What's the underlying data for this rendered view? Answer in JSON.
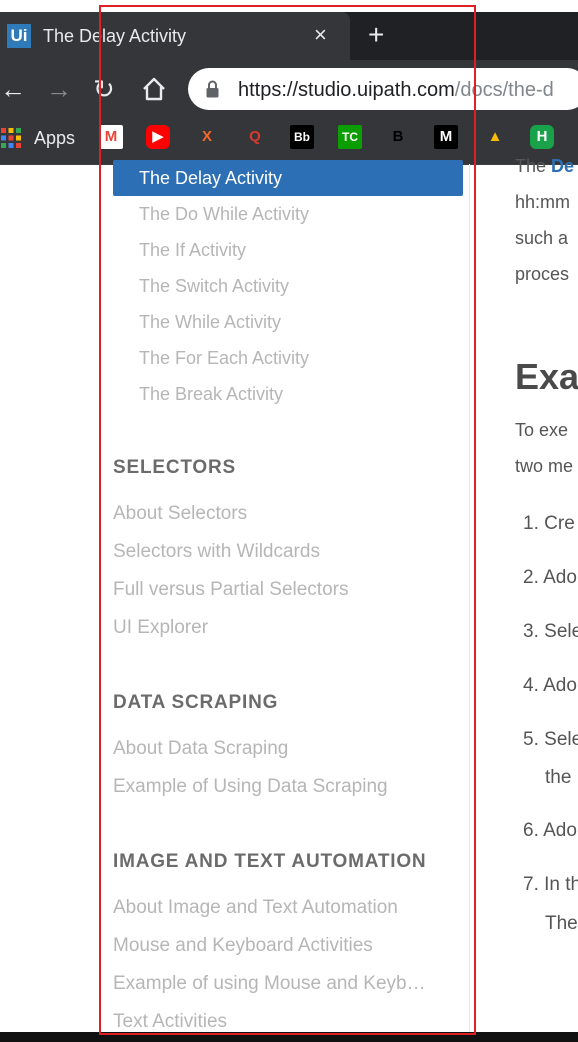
{
  "browser": {
    "tab": {
      "favicon_text": "Ui",
      "title": "The Delay Activity",
      "close": "×"
    },
    "new_tab": "+",
    "nav": {
      "back": "←",
      "forward": "→",
      "reload": "↻"
    },
    "url": {
      "main": "https://studio.uipath.com",
      "path": "/docs/the-d"
    },
    "bookmarks": {
      "apps_label": "Apps",
      "items": [
        {
          "icon": "gmail-icon",
          "glyph": "M",
          "color": "#ea4335",
          "bg": "#ffffff"
        },
        {
          "icon": "youtube-icon",
          "glyph": "▶",
          "color": "#ffffff",
          "bg": "#ff0000"
        },
        {
          "icon": "x-logo-icon",
          "glyph": "X",
          "color": "#f46a2a",
          "bg": "#35363a"
        },
        {
          "icon": "q-logo-icon",
          "glyph": "Q",
          "color": "#d93a2b",
          "bg": "#35363a"
        },
        {
          "icon": "behance-icon",
          "glyph": "Bb",
          "color": "#ffffff",
          "bg": "#000000"
        },
        {
          "icon": "techcrunch-icon",
          "glyph": "TC",
          "color": "#ffffff",
          "bg": "#0a9e01"
        },
        {
          "icon": "bold-b-icon",
          "glyph": "B",
          "color": "#000000",
          "bg": "#35363a"
        },
        {
          "icon": "medium-icon",
          "glyph": "M",
          "color": "#ffffff",
          "bg": "#000000"
        },
        {
          "icon": "google-drive-icon",
          "glyph": "▲",
          "color": "#fbbc04",
          "bg": "#35363a"
        },
        {
          "icon": "hackernoon-icon",
          "glyph": "H",
          "color": "#ffffff",
          "bg": "#1aa24a"
        }
      ]
    }
  },
  "sidebar": {
    "active": "The Delay Activity",
    "sub_items": [
      "The Do While Activity",
      "The If Activity",
      "The Switch Activity",
      "The While Activity",
      "The For Each Activity",
      "The Break Activity"
    ],
    "sections": [
      {
        "title": "SELECTORS",
        "links": [
          "About Selectors",
          "Selectors with Wildcards",
          "Full versus Partial Selectors",
          "UI Explorer"
        ]
      },
      {
        "title": "DATA SCRAPING",
        "links": [
          "About Data Scraping",
          "Example of Using Data Scraping"
        ]
      },
      {
        "title": "IMAGE AND TEXT AUTOMATION",
        "links": [
          "About Image and Text Automation",
          "Mouse and Keyboard Activities",
          "Example of using Mouse and Keyb…",
          "Text Activities"
        ]
      }
    ]
  },
  "content": {
    "intro_lines": [
      "The",
      "De",
      "hh:mm",
      "such a",
      "proces"
    ],
    "heading": "Exa",
    "para_lines": [
      "To exe",
      "two me"
    ],
    "steps": [
      {
        "num": "1.",
        "text": "Cre"
      },
      {
        "num": "2.",
        "text": "Ado"
      },
      {
        "num": "3.",
        "text": "Sele"
      },
      {
        "num": "4.",
        "text": "Ado"
      },
      {
        "num": "5.",
        "text": "Sele"
      },
      {
        "num": "6.",
        "text": "Ado"
      },
      {
        "num": "7.",
        "text": "In th"
      }
    ],
    "step5_cont": "the",
    "step7_cont": "The"
  },
  "colors": {
    "accent": "#2d6fb5",
    "annotation": "#dd1f26"
  }
}
